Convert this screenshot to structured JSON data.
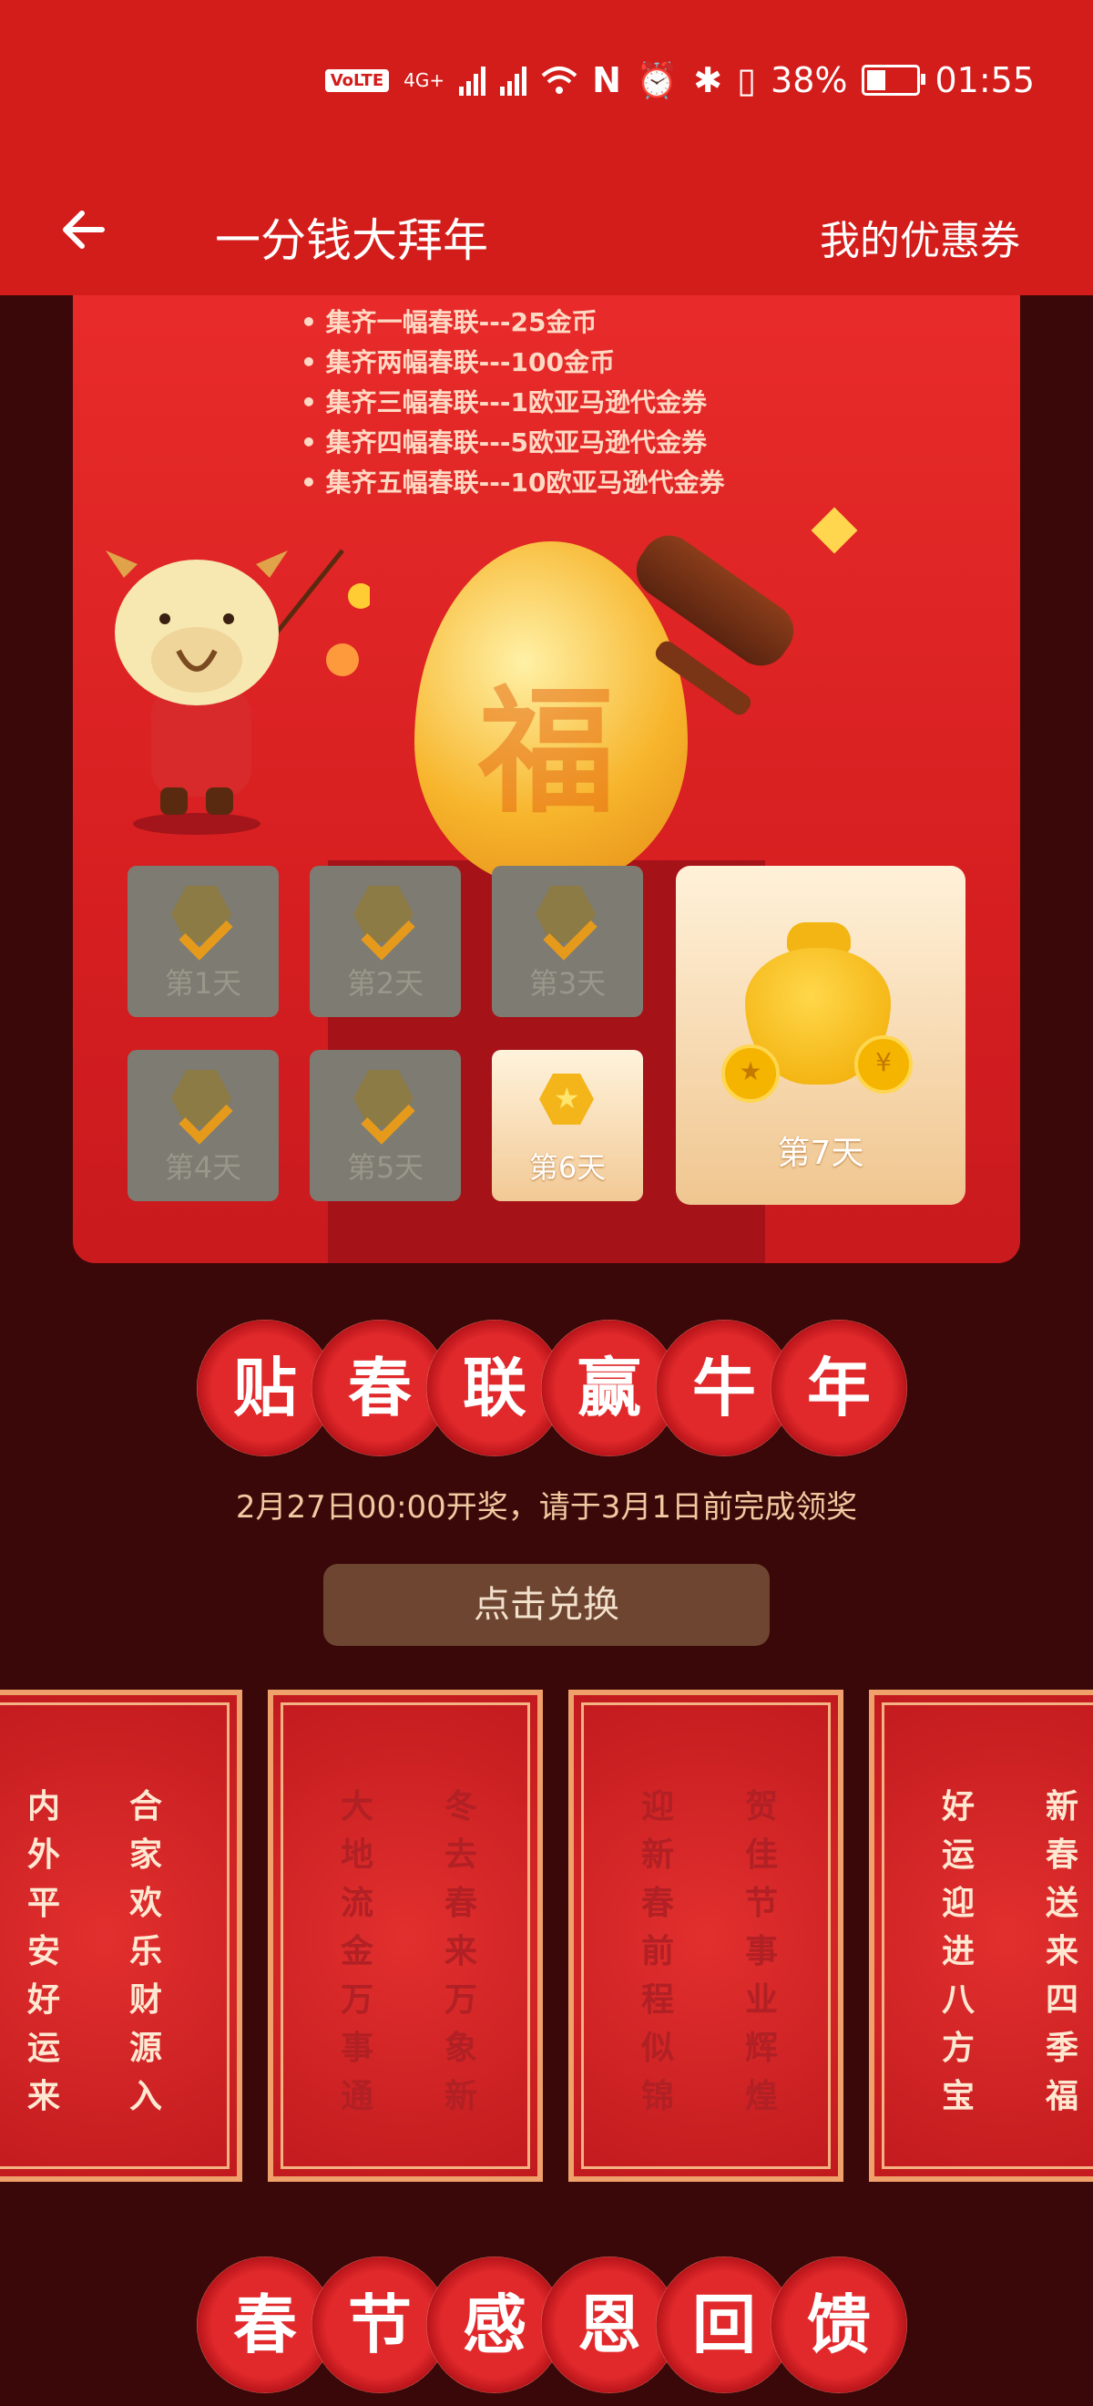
{
  "status_bar": {
    "volte": "VoLTE",
    "network": "4G+",
    "battery": "38%",
    "time": "01:55"
  },
  "header": {
    "title": "一分钱大拜年",
    "right_link": "我的优惠券"
  },
  "rules": [
    "集齐一幅春联---25金币",
    "集齐两幅春联---100金币",
    "集齐三幅春联---1欧亚马逊代金券",
    "集齐四幅春联---5欧亚马逊代金券",
    "集齐五幅春联---10欧亚马逊代金券"
  ],
  "days": [
    {
      "label": "第1天",
      "checked": true
    },
    {
      "label": "第2天",
      "checked": true
    },
    {
      "label": "第3天",
      "checked": true
    },
    {
      "label": "第4天",
      "checked": true
    },
    {
      "label": "第5天",
      "checked": true
    },
    {
      "label": "第6天",
      "checked": false
    },
    {
      "label": "第7天",
      "checked": false
    }
  ],
  "banner1": [
    "贴",
    "春",
    "联",
    "赢",
    "牛",
    "年"
  ],
  "draw_info": "2月27日00:00开奖，请于3月1日前完成领奖",
  "exchange_button": "点击兑换",
  "couplets": [
    {
      "left": "内外平安好运来",
      "right": "合家欢乐财源入"
    },
    {
      "left": "大地流金万事通",
      "right": "冬去春来万象新"
    },
    {
      "left": "迎新春前程似锦",
      "right": "贺佳节事业辉煌"
    },
    {
      "left": "好运迎进八方宝",
      "right": "新春送来四季福"
    }
  ],
  "banner2": [
    "春",
    "节",
    "感",
    "恩",
    "回",
    "馈"
  ],
  "colors": {
    "primary_red": "#d31d1a",
    "background": "#3a0808",
    "gold": "#f0c9a1"
  }
}
